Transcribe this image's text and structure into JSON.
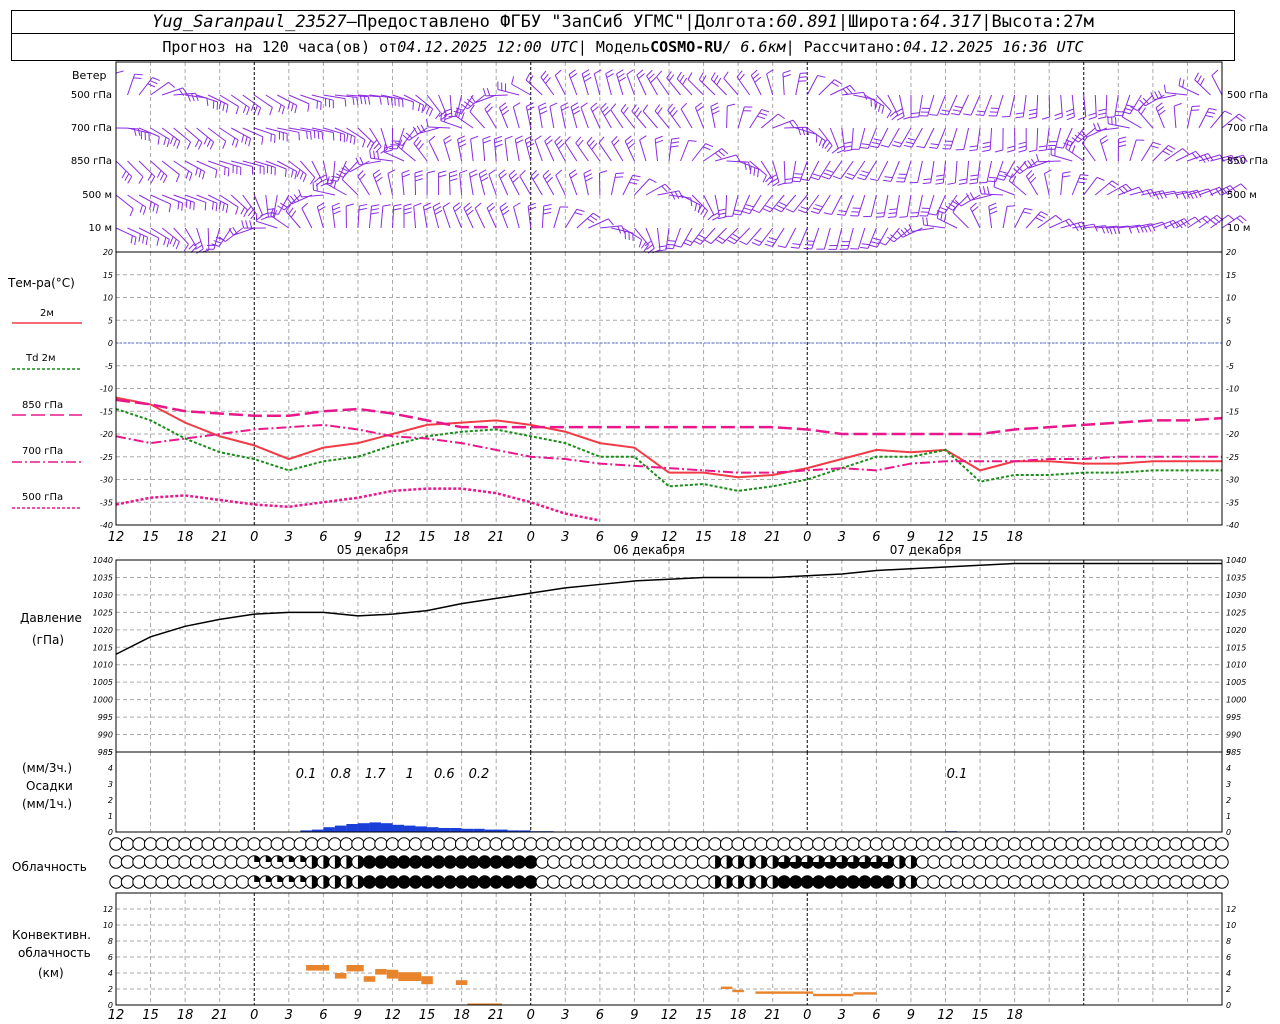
{
  "header": {
    "station": "Yug_Saranpaul_23527",
    "dash": " – ",
    "provided": "Предоставлено ФГБУ \"ЗапСиб УГМС\"",
    "sep": " | ",
    "lon_label": "Долгота: ",
    "lon": "60.891",
    "lat_label": "Широта: ",
    "lat": "64.317",
    "alt_label": "Высота: ",
    "alt": "27м",
    "forecast_label": "Прогноз на 120 часа(ов)  от ",
    "forecast_start": "04.12.2025 12:00 UTC",
    "model_label": "| Модель ",
    "model": "COSMO-RU",
    "model_res": " / 6.6км",
    "computed_label": " | Рассчитано: ",
    "computed": "04.12.2025 16:36 UTC"
  },
  "colors": {
    "wind": "#8a2be2",
    "t2m": "#f03c46",
    "td2m": "#1a8c1a",
    "t850": "#e8188c",
    "t700": "#e8188c",
    "t500": "#e8188c",
    "zero_line": "#4060e0",
    "pressure": "#000000",
    "precip": "#1a3ed8",
    "convective": "#e8842c",
    "grid": "#aaaaaa"
  },
  "wind_panel": {
    "title": "Ветер",
    "levels": [
      "500 гПа",
      "700 гПа",
      "850 гПа",
      "500 м",
      "10  м"
    ],
    "levels_right": [
      "500 гПа",
      "700 гПа",
      "850 гПа",
      "500 м",
      "10  м"
    ]
  },
  "temperature_panel": {
    "title": "Тем-ра(°С)",
    "legend": [
      {
        "key": "t2m",
        "label": "2м"
      },
      {
        "key": "td2m",
        "label": "Td  2м"
      },
      {
        "key": "t850",
        "label": "850 гПа"
      },
      {
        "key": "t700",
        "label": "700 гПа"
      },
      {
        "key": "t500",
        "label": "500 гПа"
      }
    ]
  },
  "pressure_panel": {
    "title": "Давление",
    "unit": "(гПа)"
  },
  "precip_panel": {
    "unit3h": "(мм/3ч.)",
    "title": "Осадки",
    "unit1h": "(мм/1ч.)"
  },
  "cloud_panel": {
    "title": "Облачность"
  },
  "convective_panel": {
    "title_1": "Конвективн.",
    "title_2": "облачность",
    "unit": "(км)"
  },
  "time_axis": {
    "hour_labels": [
      "12",
      "15",
      "18",
      "21",
      "0",
      "3",
      "6",
      "9",
      "12",
      "15",
      "18",
      "21",
      "0",
      "3",
      "6",
      "9",
      "12",
      "15",
      "18",
      "21",
      "0",
      "3",
      "6",
      "9",
      "12",
      "15",
      "18"
    ],
    "date_labels": [
      {
        "hour": 24,
        "label": "05 декабря"
      },
      {
        "hour": 48,
        "label": "06 декабря"
      },
      {
        "hour": 72,
        "label": "07 декабря"
      }
    ]
  },
  "chart_data": [
    {
      "type": "line",
      "name": "temperature",
      "ylabel": "Тем-ра(°С)",
      "x_unit": "hours since 04.12.2025 12:00 UTC",
      "ylim": [
        -40,
        20
      ],
      "yticks": [
        20,
        15,
        10,
        5,
        0,
        -5,
        -10,
        -15,
        -20,
        -25,
        -30,
        -35,
        -40
      ],
      "series": [
        {
          "name": "2м",
          "x": [
            0,
            3,
            6,
            9,
            12,
            15,
            18,
            21,
            24,
            27,
            30,
            33,
            36,
            39,
            42,
            45,
            48,
            51,
            54,
            57,
            60,
            63,
            66,
            69,
            72,
            75,
            78,
            81,
            84,
            87,
            90,
            93,
            96
          ],
          "values": [
            -12,
            -13.5,
            -17.5,
            -20.5,
            -22.5,
            -25.5,
            -23,
            -22,
            -20,
            -18,
            -17.5,
            -17,
            -18,
            -19.5,
            -22,
            -23,
            -28.5,
            -28.5,
            -29.5,
            -29,
            -27.5,
            -25.5,
            -23.5,
            -24,
            -23.5,
            -28,
            -26,
            -26,
            -26.5,
            -26.5,
            -26,
            -26,
            -26
          ]
        },
        {
          "name": "Td  2м",
          "x": [
            0,
            3,
            6,
            9,
            12,
            15,
            18,
            21,
            24,
            27,
            30,
            33,
            36,
            39,
            42,
            45,
            48,
            51,
            54,
            57,
            60,
            63,
            66,
            69,
            72,
            75,
            78,
            81,
            84,
            87,
            90,
            93,
            96
          ],
          "values": [
            -14.5,
            -17,
            -21,
            -24,
            -25.5,
            -28,
            -26,
            -25,
            -22.5,
            -20.5,
            -19.5,
            -19,
            -20.5,
            -22,
            -25,
            -25,
            -31.5,
            -31,
            -32.5,
            -31.5,
            -30,
            -27.5,
            -25,
            -25,
            -23.5,
            -30.5,
            -29,
            -29,
            -28.5,
            -28.5,
            -28,
            -28,
            -28
          ]
        },
        {
          "name": "850 гПа",
          "x": [
            0,
            3,
            6,
            9,
            12,
            15,
            18,
            21,
            24,
            27,
            30,
            33,
            36,
            39,
            42,
            45,
            48,
            51,
            54,
            57,
            60,
            63,
            66,
            69,
            72,
            75,
            78,
            81,
            84,
            87,
            90,
            93,
            96
          ],
          "values": [
            -12.5,
            -13.5,
            -15,
            -15.5,
            -16,
            -16,
            -15,
            -14.5,
            -15.5,
            -17,
            -18.5,
            -18.5,
            -18.5,
            -18.5,
            -18.5,
            -18.5,
            -18.5,
            -18.5,
            -18.5,
            -18.5,
            -19,
            -20,
            -20,
            -20,
            -20,
            -20,
            -19,
            -18.5,
            -18,
            -17.5,
            -17,
            -17,
            -16.5
          ]
        },
        {
          "name": "700 гПа",
          "x": [
            0,
            3,
            6,
            9,
            12,
            15,
            18,
            21,
            24,
            27,
            30,
            33,
            36,
            39,
            42,
            45,
            48,
            51,
            54,
            57,
            60,
            63,
            66,
            69,
            72,
            75,
            78,
            81,
            84,
            87,
            90,
            93,
            96
          ],
          "values": [
            -20.5,
            -22,
            -21,
            -20,
            -19,
            -18.5,
            -18,
            -19,
            -20.5,
            -21,
            -22,
            -23.5,
            -25,
            -25.5,
            -26.5,
            -27,
            -27.5,
            -28,
            -28.5,
            -28.5,
            -28,
            -27.5,
            -28,
            -26.5,
            -26,
            -26,
            -26,
            -25.5,
            -25.5,
            -25,
            -25,
            -25,
            -25
          ]
        },
        {
          "name": "500 гПа",
          "x": [
            0,
            3,
            6,
            9,
            12,
            15,
            18,
            21,
            24,
            27,
            30,
            33,
            36,
            39,
            42,
            45,
            48,
            51,
            54,
            57,
            60,
            63,
            66,
            69,
            72,
            75,
            78,
            81,
            84,
            87,
            90,
            93,
            96
          ],
          "values": [
            -35.5,
            -34,
            -33.5,
            -34.5,
            -35.5,
            -36,
            -35,
            -34,
            -32.5,
            -32,
            -32,
            -33,
            -35,
            -37.5,
            -39,
            -40.5,
            -42,
            -43,
            -43,
            -43,
            -43,
            -43,
            -43,
            -43,
            -43,
            -43,
            -43,
            -43,
            -43,
            -43,
            -43,
            -43,
            -43
          ]
        }
      ]
    },
    {
      "type": "line",
      "name": "pressure",
      "ylabel": "Давление (гПа)",
      "x_unit": "hours since 04.12.2025 12:00 UTC",
      "ylim": [
        985,
        1040
      ],
      "yticks": [
        1040,
        1035,
        1030,
        1025,
        1020,
        1015,
        1010,
        1005,
        1000,
        995,
        990,
        985
      ],
      "series": [
        {
          "name": "Давление",
          "x": [
            0,
            3,
            6,
            9,
            12,
            15,
            18,
            21,
            24,
            27,
            30,
            33,
            36,
            39,
            42,
            45,
            48,
            51,
            54,
            57,
            60,
            63,
            66,
            69,
            72,
            75,
            78,
            81,
            84,
            87,
            90,
            93,
            96
          ],
          "values": [
            1013,
            1018,
            1021,
            1023,
            1024.5,
            1025,
            1025,
            1024,
            1024.5,
            1025.5,
            1027.5,
            1029,
            1030.5,
            1032,
            1033,
            1034,
            1034.5,
            1035,
            1035,
            1035,
            1035.5,
            1036,
            1037,
            1037.5,
            1038,
            1038.5,
            1039,
            1039,
            1039,
            1039,
            1039,
            1039,
            1039
          ]
        }
      ]
    },
    {
      "type": "bar",
      "name": "precipitation",
      "ylabel": "Осадки (мм/1ч.)",
      "x_unit": "hours since 04.12.2025 12:00 UTC",
      "ylim": [
        0,
        5
      ],
      "yticks": [
        5,
        4,
        3,
        2,
        1,
        0
      ],
      "x": [
        16,
        17,
        18,
        19,
        20,
        21,
        22,
        23,
        24,
        25,
        26,
        27,
        28,
        29,
        30,
        31,
        32,
        33,
        34,
        35,
        36,
        37,
        72
      ],
      "values": [
        0.1,
        0.15,
        0.3,
        0.4,
        0.5,
        0.55,
        0.6,
        0.55,
        0.45,
        0.4,
        0.35,
        0.3,
        0.25,
        0.25,
        0.2,
        0.2,
        0.15,
        0.15,
        0.1,
        0.1,
        0.05,
        0.05,
        0.05
      ],
      "labels_3h": [
        {
          "hour": 16.5,
          "value": "0.1"
        },
        {
          "hour": 19.5,
          "value": "0.8"
        },
        {
          "hour": 22.5,
          "value": "1.7"
        },
        {
          "hour": 25.5,
          "value": "1"
        },
        {
          "hour": 28.5,
          "value": "0.6"
        },
        {
          "hour": 31.5,
          "value": "0.2"
        },
        {
          "hour": 73,
          "value": "0.1"
        }
      ]
    },
    {
      "type": "table",
      "name": "cloudiness",
      "ylabel": "Облачность",
      "rows": [
        "upper",
        "middle",
        "lower"
      ],
      "values_octas": {
        "upper": [
          0,
          0,
          0,
          0,
          0,
          0,
          0,
          0,
          0,
          0,
          0,
          0,
          0,
          0,
          0,
          0,
          0,
          0,
          0,
          0,
          0,
          0,
          0,
          0,
          0,
          0,
          0,
          0,
          0,
          0,
          0,
          0,
          0,
          0,
          0,
          0,
          0,
          0,
          0,
          0,
          0,
          0,
          0,
          0,
          0,
          0,
          0,
          0,
          0,
          0,
          0,
          0,
          0,
          0,
          0,
          0,
          0,
          0,
          0,
          0,
          0,
          0,
          0,
          0,
          0,
          0,
          0,
          0,
          0,
          0,
          0,
          0,
          0,
          0,
          0,
          0,
          0,
          0,
          0,
          0,
          0,
          0,
          0,
          0,
          0,
          0,
          0,
          0,
          0,
          0,
          0,
          0,
          0,
          0,
          0,
          0,
          0
        ],
        "middle": [
          0,
          0,
          0,
          0,
          0,
          0,
          0,
          0,
          0,
          0,
          0,
          0,
          0,
          0,
          0,
          0,
          0,
          0,
          0,
          0,
          0,
          0,
          0,
          0,
          0,
          0,
          0,
          0,
          0,
          0,
          0,
          0,
          0,
          0,
          0,
          0,
          0,
          0,
          0,
          0,
          0,
          0,
          0,
          0,
          0,
          0,
          0,
          0,
          0,
          0,
          0,
          0,
          0,
          0,
          0,
          0,
          0,
          0,
          0,
          0,
          0,
          0,
          0,
          0,
          0,
          0,
          0,
          0,
          0,
          0,
          0,
          0,
          0,
          0,
          0,
          0,
          0,
          0,
          0,
          0,
          0,
          0,
          0,
          0,
          0,
          0,
          0,
          0,
          0,
          0,
          0,
          0,
          0,
          0,
          0,
          0,
          0
        ],
        "lower": [
          0,
          0,
          0,
          0,
          0,
          0,
          0,
          0,
          0,
          0,
          0,
          0,
          0,
          0,
          0,
          0,
          0,
          0,
          0,
          0,
          0,
          0,
          0,
          0,
          0,
          0,
          0,
          0,
          0,
          0,
          0,
          0,
          0,
          0,
          0,
          0,
          0,
          0,
          0,
          0,
          0,
          0,
          0,
          0,
          0,
          0,
          0,
          0,
          0,
          0,
          0,
          0,
          0,
          0,
          0,
          0,
          0,
          0,
          0,
          0,
          0,
          0,
          0,
          0,
          0,
          0,
          0,
          0,
          0,
          0,
          0,
          0,
          0,
          0,
          0,
          0,
          0,
          0,
          0,
          0,
          0,
          0,
          0,
          0,
          0,
          0,
          0,
          0,
          0,
          0,
          0,
          0,
          0,
          0,
          0,
          0,
          0
        ]
      }
    },
    {
      "type": "bar",
      "name": "convective_cloud",
      "ylabel": "Конвективн. облачность (км)",
      "x_unit": "hours since 04.12.2025 12:00 UTC",
      "ylim": [
        0,
        14
      ],
      "yticks": [
        12,
        10,
        8,
        6,
        4,
        2,
        0
      ],
      "segments": [
        {
          "x0": 16.5,
          "x1": 18.5,
          "base": 4.3,
          "top": 5.0
        },
        {
          "x0": 19.0,
          "x1": 20.0,
          "base": 3.3,
          "top": 4.0
        },
        {
          "x0": 20.0,
          "x1": 21.5,
          "base": 4.2,
          "top": 5.0
        },
        {
          "x0": 21.5,
          "x1": 22.5,
          "base": 2.9,
          "top": 3.6
        },
        {
          "x0": 22.5,
          "x1": 23.5,
          "base": 3.8,
          "top": 4.5
        },
        {
          "x0": 23.5,
          "x1": 24.5,
          "base": 3.3,
          "top": 4.4
        },
        {
          "x0": 24.5,
          "x1": 26.5,
          "base": 3.0,
          "top": 4.1
        },
        {
          "x0": 26.5,
          "x1": 27.5,
          "base": 2.6,
          "top": 3.6
        },
        {
          "x0": 29.5,
          "x1": 30.5,
          "base": 2.5,
          "top": 3.1
        },
        {
          "x0": 30.5,
          "x1": 33.5,
          "base": 0.0,
          "top": 0.2
        },
        {
          "x0": 52.5,
          "x1": 53.5,
          "base": 2.0,
          "top": 2.3
        },
        {
          "x0": 53.5,
          "x1": 54.5,
          "base": 1.6,
          "top": 1.9
        },
        {
          "x0": 55.5,
          "x1": 59.5,
          "base": 1.4,
          "top": 1.7
        },
        {
          "x0": 59.5,
          "x1": 60.5,
          "base": 1.4,
          "top": 1.7
        },
        {
          "x0": 60.5,
          "x1": 64.0,
          "base": 1.1,
          "top": 1.4
        },
        {
          "x0": 64.0,
          "x1": 66.0,
          "base": 1.3,
          "top": 1.6
        }
      ]
    }
  ]
}
